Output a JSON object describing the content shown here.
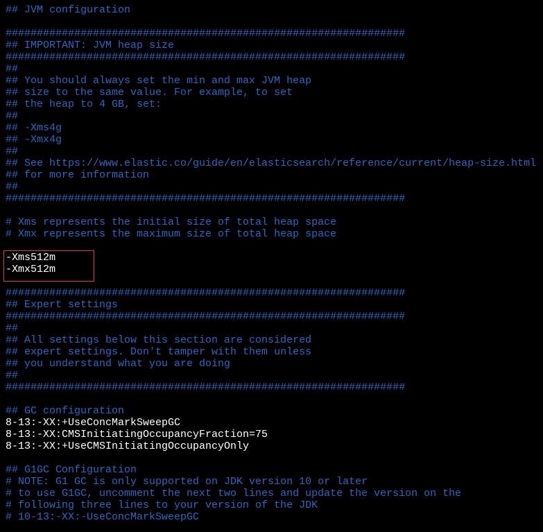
{
  "colors": {
    "comment": "#2e67c0",
    "setting": "#ffffff",
    "highlight_box": "#e03c3c",
    "background": "#000000"
  },
  "lines": [
    {
      "text": "## JVM configuration",
      "kind": "comment"
    },
    {
      "text": "",
      "kind": "comment"
    },
    {
      "text": "################################################################",
      "kind": "comment"
    },
    {
      "text": "## IMPORTANT: JVM heap size",
      "kind": "comment"
    },
    {
      "text": "################################################################",
      "kind": "comment"
    },
    {
      "text": "##",
      "kind": "comment"
    },
    {
      "text": "## You should always set the min and max JVM heap",
      "kind": "comment"
    },
    {
      "text": "## size to the same value. For example, to set",
      "kind": "comment"
    },
    {
      "text": "## the heap to 4 GB, set:",
      "kind": "comment"
    },
    {
      "text": "##",
      "kind": "comment"
    },
    {
      "text": "## -Xms4g",
      "kind": "comment"
    },
    {
      "text": "## -Xmx4g",
      "kind": "comment"
    },
    {
      "text": "##",
      "kind": "comment"
    },
    {
      "text": "## See https://www.elastic.co/guide/en/elasticsearch/reference/current/heap-size.html",
      "kind": "comment"
    },
    {
      "text": "## for more information",
      "kind": "comment"
    },
    {
      "text": "##",
      "kind": "comment"
    },
    {
      "text": "################################################################",
      "kind": "comment"
    },
    {
      "text": "",
      "kind": "comment"
    },
    {
      "text": "# Xms represents the initial size of total heap space",
      "kind": "comment"
    },
    {
      "text": "# Xmx represents the maximum size of total heap space",
      "kind": "comment"
    },
    {
      "text": "",
      "kind": "comment"
    },
    {
      "text": "-Xms512m",
      "kind": "setting"
    },
    {
      "text": "-Xmx512m",
      "kind": "setting"
    },
    {
      "text": "",
      "kind": "comment"
    },
    {
      "text": "################################################################",
      "kind": "comment"
    },
    {
      "text": "## Expert settings",
      "kind": "comment"
    },
    {
      "text": "################################################################",
      "kind": "comment"
    },
    {
      "text": "##",
      "kind": "comment"
    },
    {
      "text": "## All settings below this section are considered",
      "kind": "comment"
    },
    {
      "text": "## expert settings. Don't tamper with them unless",
      "kind": "comment"
    },
    {
      "text": "## you understand what you are doing",
      "kind": "comment"
    },
    {
      "text": "##",
      "kind": "comment"
    },
    {
      "text": "################################################################",
      "kind": "comment"
    },
    {
      "text": "",
      "kind": "comment"
    },
    {
      "text": "## GC configuration",
      "kind": "comment"
    },
    {
      "text": "8-13:-XX:+UseConcMarkSweepGC",
      "kind": "setting"
    },
    {
      "text": "8-13:-XX:CMSInitiatingOccupancyFraction=75",
      "kind": "setting"
    },
    {
      "text": "8-13:-XX:+UseCMSInitiatingOccupancyOnly",
      "kind": "setting"
    },
    {
      "text": "",
      "kind": "comment"
    },
    {
      "text": "## G1GC Configuration",
      "kind": "comment"
    },
    {
      "text": "# NOTE: G1 GC is only supported on JDK version 10 or later",
      "kind": "comment"
    },
    {
      "text": "# to use G1GC, uncomment the next two lines and update the version on the",
      "kind": "comment"
    },
    {
      "text": "# following three lines to your version of the JDK",
      "kind": "comment"
    },
    {
      "text": "# 10-13:-XX:-UseConcMarkSweepGC",
      "kind": "comment"
    }
  ]
}
